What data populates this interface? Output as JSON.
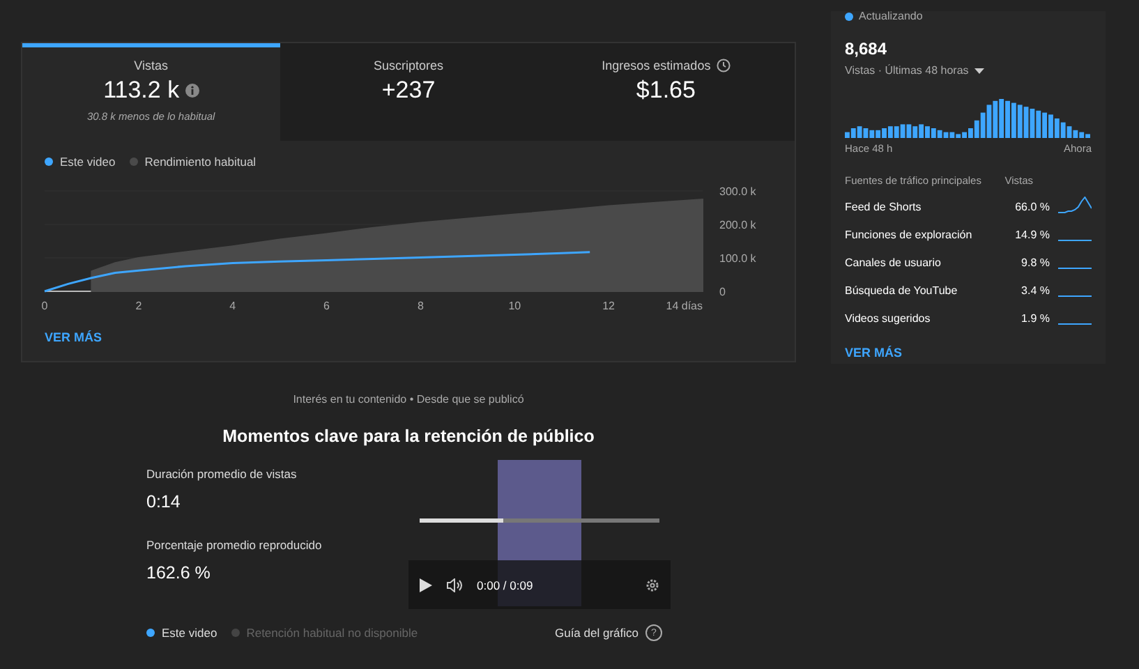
{
  "metrics": [
    {
      "label": "Vistas",
      "value": "113.2 k",
      "note": "30.8 k menos de lo habitual",
      "selected": true
    },
    {
      "label": "Suscriptores",
      "value": "+237",
      "selected": false
    },
    {
      "label": "Ingresos estimados",
      "value": "$1.65",
      "selected": false
    }
  ],
  "chart_data": {
    "type": "line",
    "x": [
      0,
      0.5,
      1,
      1.5,
      2,
      3,
      4,
      5,
      6,
      7,
      8,
      9,
      10,
      11,
      11.6,
      12,
      13,
      14
    ],
    "series": [
      {
        "name": "Este video",
        "color": "#3ea6ff",
        "values": [
          0,
          22000,
          40000,
          55000,
          62000,
          75000,
          84000,
          89000,
          93000,
          97000,
          101000,
          105000,
          109000,
          114000,
          117000,
          null,
          null,
          null
        ]
      },
      {
        "name": "Rendimiento habitual",
        "type": "area",
        "color": "#4a4a4a",
        "values": [
          null,
          null,
          60000,
          85000,
          100000,
          118000,
          135000,
          155000,
          172000,
          190000,
          205000,
          218000,
          230000,
          242000,
          250000,
          255000,
          265000,
          275000
        ]
      }
    ],
    "xlim": [
      0,
      14
    ],
    "ylim": [
      0,
      300000
    ],
    "xticks": [
      0,
      2,
      4,
      6,
      8,
      10,
      12,
      {
        "value": 14,
        "label": "14 días"
      }
    ],
    "yticks": [
      {
        "value": 0,
        "label": "0"
      },
      {
        "value": 100000,
        "label": "100.0 k"
      },
      {
        "value": 200000,
        "label": "200.0 k"
      },
      {
        "value": 300000,
        "label": "300.0 k"
      }
    ]
  },
  "card_link": "VER MÁS",
  "realtime": {
    "status": "Actualizando",
    "count": "8,684",
    "period": "Vistas · Últimas 48 horas",
    "start_label": "Hace 48 h",
    "end_label": "Ahora",
    "sources_header": "Fuentes de tráfico principales",
    "views_header": "Vistas",
    "sources": [
      {
        "name": "Feed de Shorts",
        "share": "66.0 %"
      },
      {
        "name": "Funciones de exploración",
        "share": "14.9 %"
      },
      {
        "name": "Canales de usuario",
        "share": "9.8 %"
      },
      {
        "name": "Búsqueda de YouTube",
        "share": "3.4 %"
      },
      {
        "name": "Videos sugeridos",
        "share": "1.9 %"
      }
    ],
    "link": "VER MÁS"
  },
  "retention": {
    "caption": "Interés en tu contenido • Desde que se publicó",
    "title": "Momentos clave para la retención de público",
    "stats": [
      {
        "label": "Duración promedio de vistas",
        "value": "0:14"
      },
      {
        "label": "Porcentaje promedio reproducido",
        "value": "162.6 %"
      }
    ],
    "player": {
      "time": "0:00 / 0:09",
      "level": 0.35
    },
    "legend": [
      {
        "label": "Este video",
        "disabled": false
      },
      {
        "label": "Retención habitual no disponible",
        "disabled": true
      }
    ],
    "guide": "Guía del gráfico",
    "guide_icon": "?"
  }
}
